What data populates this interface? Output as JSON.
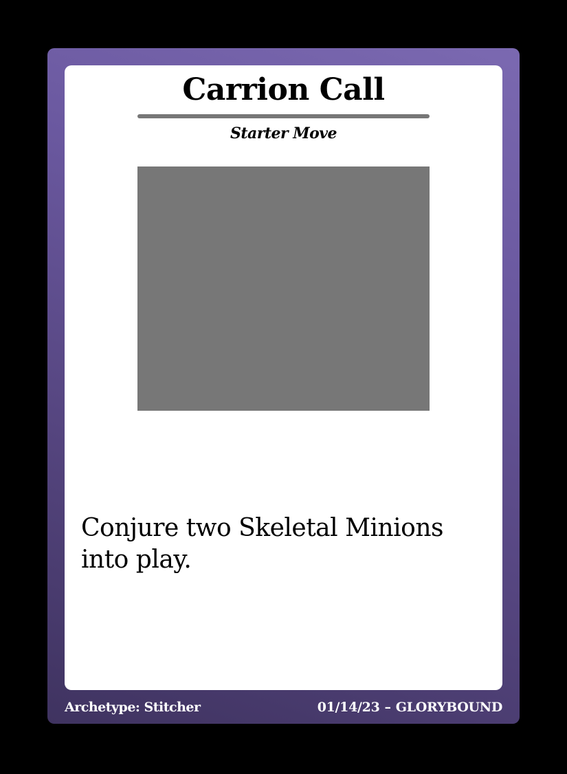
{
  "card": {
    "title": "Carrion Call",
    "subtitle": "Starter Move",
    "art_placeholder": "",
    "rules_text": "Conjure two Skeletal Minions into play.",
    "footer": {
      "archetype": "Archetype: Stitcher",
      "date": "01/14/23",
      "separator": "–",
      "brand": "GLORYBOUND"
    }
  },
  "colors": {
    "background": "#000000",
    "frame_top": "#7b69b1",
    "frame_bottom": "#3f3360",
    "panel": "#ffffff",
    "rule": "#777777",
    "art_placeholder": "#777777"
  }
}
